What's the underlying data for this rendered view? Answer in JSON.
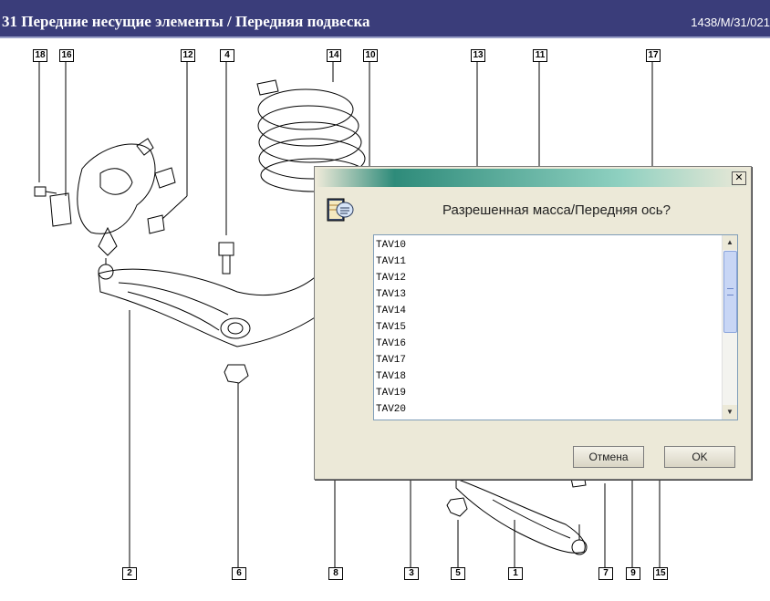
{
  "header": {
    "title": "31 Передние несущие элементы / Передняя подвеска",
    "doc_code": "1438/M/31/021"
  },
  "diagram": {
    "callouts_top": [
      "18",
      "16",
      "12",
      "4",
      "14",
      "10",
      "13",
      "11",
      "17"
    ],
    "callouts_bottom": [
      "2",
      "6",
      "8",
      "3",
      "5",
      "1",
      "7",
      "9",
      "15"
    ]
  },
  "dialog": {
    "question": "Разрешенная масса/Передняя ось?",
    "close_glyph": "✕",
    "options": [
      "TAV10",
      "TAV11",
      "TAV12",
      "TAV13",
      "TAV14",
      "TAV15",
      "TAV16",
      "TAV17",
      "TAV18",
      "TAV19",
      "TAV20"
    ],
    "cancel_label": "Отмена",
    "ok_label": "OK",
    "icon": "notepad-speech-icon"
  },
  "colors": {
    "titlebar": "#3a3d7a",
    "dialog_bg": "#ece9d8",
    "dialog_gradient": "#2e8b7a"
  }
}
